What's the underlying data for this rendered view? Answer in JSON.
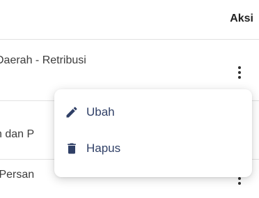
{
  "table": {
    "action_header": "Aksi",
    "rows": [
      {
        "text": "Daerah - Retribusi"
      },
      {
        "text": "n dan P"
      },
      {
        "text": "/Persan"
      }
    ]
  },
  "context_menu": {
    "items": [
      {
        "label": "Ubah",
        "icon": "pencil-icon"
      },
      {
        "label": "Hapus",
        "icon": "trash-icon"
      }
    ],
    "text_color": "#2f3f66"
  }
}
